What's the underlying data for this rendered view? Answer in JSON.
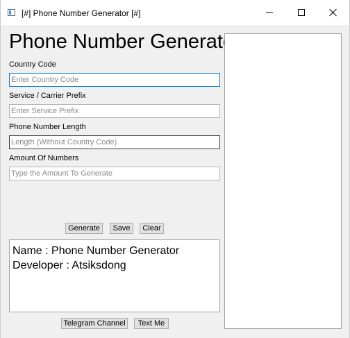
{
  "window": {
    "title": "[#] Phone Number Generator [#]"
  },
  "main": {
    "heading": "Phone Number Generator",
    "fields": [
      {
        "label": "Country Code",
        "placeholder": "Enter Country Code",
        "value": ""
      },
      {
        "label": "Service / Carrier Prefix",
        "placeholder": "Enter Service Prefix",
        "value": ""
      },
      {
        "label": "Phone Number Length",
        "placeholder": "Length (Without Country Code)",
        "value": ""
      },
      {
        "label": "Amount Of Numbers",
        "placeholder": "Type the Amount To Generate",
        "value": ""
      }
    ],
    "buttons": {
      "generate": "Generate",
      "save": "Save",
      "clear": "Clear"
    },
    "info": {
      "line1": "Name : Phone Number Generator",
      "line2": "Developer : Atsiksdong"
    },
    "footer_buttons": {
      "telegram": "Telegram Channel",
      "text_me": "Text Me"
    }
  },
  "output": {
    "text": ""
  }
}
